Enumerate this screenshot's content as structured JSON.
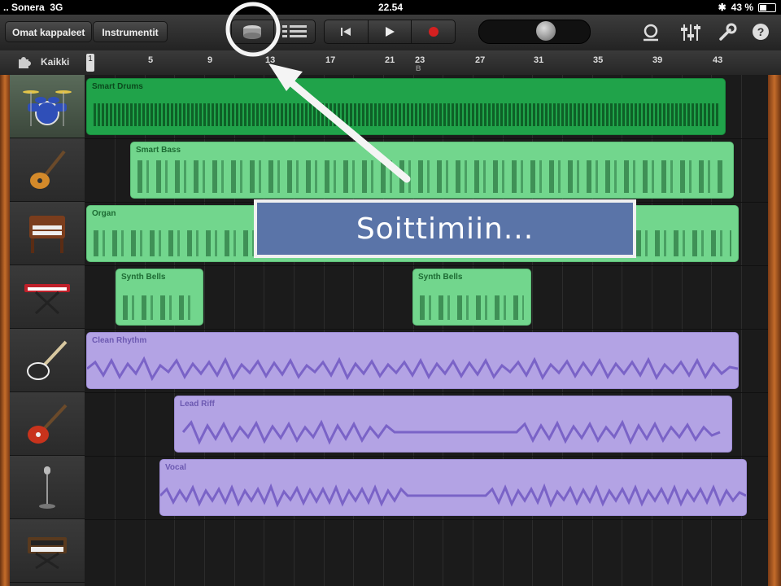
{
  "status_bar": {
    "carrier": "Sonera",
    "network": "3G",
    "time": "22.54",
    "battery": "43 %"
  },
  "toolbar": {
    "my_songs": "Omat kappaleet",
    "instruments": "Instrumentit"
  },
  "ruler": {
    "all_label": "Kaikki",
    "ticks": [
      "1",
      "5",
      "9",
      "13",
      "17",
      "21",
      "23",
      "27",
      "31",
      "35",
      "39",
      "43"
    ],
    "section_marker": "B"
  },
  "tracks": [
    {
      "name": "Smart Drums",
      "icon": "drum-kit-icon",
      "color": "#20a34a"
    },
    {
      "name": "Smart Bass",
      "icon": "bass-guitar-icon",
      "color": "#72d68d"
    },
    {
      "name": "Organ",
      "icon": "organ-icon",
      "color": "#72d68d"
    },
    {
      "name": "Synth Bells",
      "icon": "keyboard-icon",
      "color": "#72d68d"
    },
    {
      "name": "Clean Rhythm",
      "icon": "electric-guitar-icon",
      "color": "#b3a3e4"
    },
    {
      "name": "Lead Riff",
      "icon": "lead-guitar-icon",
      "color": "#b3a3e4"
    },
    {
      "name": "Vocal",
      "icon": "microphone-icon",
      "color": "#b3a3e4"
    },
    {
      "name": "",
      "icon": "synth-icon",
      "color": "#b3a3e4"
    }
  ],
  "regions": {
    "smart_drums": "Smart Drums",
    "smart_bass": "Smart Bass",
    "organ": "Organ",
    "synth_bells_1": "Synth Bells",
    "synth_bells_2": "Synth Bells",
    "clean_rhythm": "Clean Rhythm",
    "lead_riff": "Lead Riff",
    "vocal": "Vocal"
  },
  "annotation": {
    "text": "Soittimiin..."
  }
}
